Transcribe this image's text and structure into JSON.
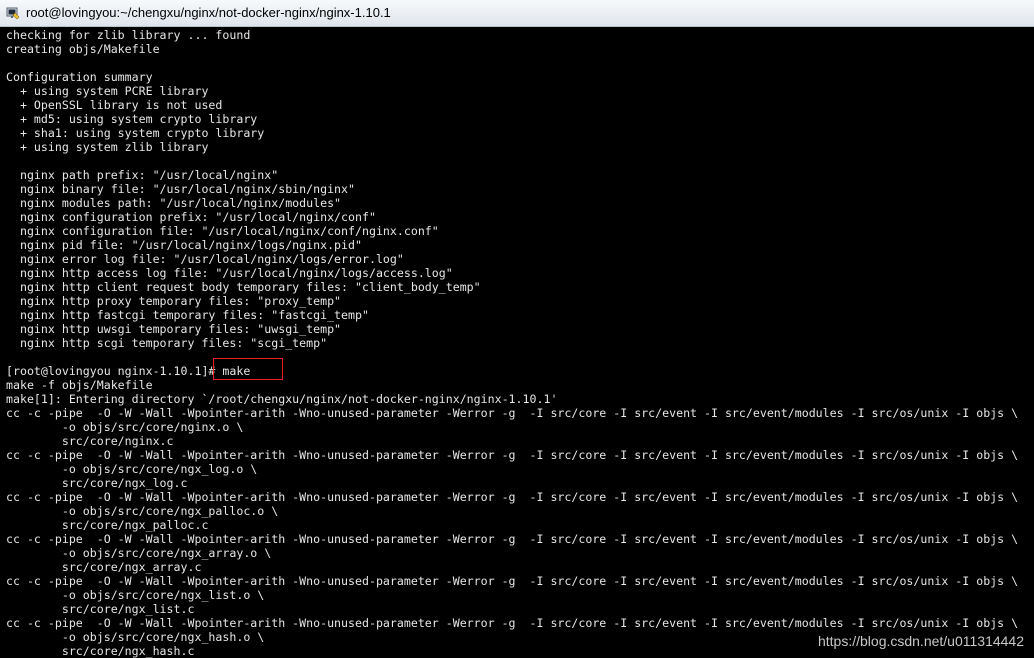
{
  "window": {
    "title": "root@lovingyou:~/chengxu/nginx/not-docker-nginx/nginx-1.10.1"
  },
  "terminal": {
    "lines": [
      "checking for zlib library ... found",
      "creating objs/Makefile",
      "",
      "Configuration summary",
      "  + using system PCRE library",
      "  + OpenSSL library is not used",
      "  + md5: using system crypto library",
      "  + sha1: using system crypto library",
      "  + using system zlib library",
      "",
      "  nginx path prefix: \"/usr/local/nginx\"",
      "  nginx binary file: \"/usr/local/nginx/sbin/nginx\"",
      "  nginx modules path: \"/usr/local/nginx/modules\"",
      "  nginx configuration prefix: \"/usr/local/nginx/conf\"",
      "  nginx configuration file: \"/usr/local/nginx/conf/nginx.conf\"",
      "  nginx pid file: \"/usr/local/nginx/logs/nginx.pid\"",
      "  nginx error log file: \"/usr/local/nginx/logs/error.log\"",
      "  nginx http access log file: \"/usr/local/nginx/logs/access.log\"",
      "  nginx http client request body temporary files: \"client_body_temp\"",
      "  nginx http proxy temporary files: \"proxy_temp\"",
      "  nginx http fastcgi temporary files: \"fastcgi_temp\"",
      "  nginx http uwsgi temporary files: \"uwsgi_temp\"",
      "  nginx http scgi temporary files: \"scgi_temp\"",
      "",
      "[root@lovingyou nginx-1.10.1]# make",
      "make -f objs/Makefile",
      "make[1]: Entering directory `/root/chengxu/nginx/not-docker-nginx/nginx-1.10.1'",
      "cc -c -pipe  -O -W -Wall -Wpointer-arith -Wno-unused-parameter -Werror -g  -I src/core -I src/event -I src/event/modules -I src/os/unix -I objs \\",
      "        -o objs/src/core/nginx.o \\",
      "        src/core/nginx.c",
      "cc -c -pipe  -O -W -Wall -Wpointer-arith -Wno-unused-parameter -Werror -g  -I src/core -I src/event -I src/event/modules -I src/os/unix -I objs \\",
      "        -o objs/src/core/ngx_log.o \\",
      "        src/core/ngx_log.c",
      "cc -c -pipe  -O -W -Wall -Wpointer-arith -Wno-unused-parameter -Werror -g  -I src/core -I src/event -I src/event/modules -I src/os/unix -I objs \\",
      "        -o objs/src/core/ngx_palloc.o \\",
      "        src/core/ngx_palloc.c",
      "cc -c -pipe  -O -W -Wall -Wpointer-arith -Wno-unused-parameter -Werror -g  -I src/core -I src/event -I src/event/modules -I src/os/unix -I objs \\",
      "        -o objs/src/core/ngx_array.o \\",
      "        src/core/ngx_array.c",
      "cc -c -pipe  -O -W -Wall -Wpointer-arith -Wno-unused-parameter -Werror -g  -I src/core -I src/event -I src/event/modules -I src/os/unix -I objs \\",
      "        -o objs/src/core/ngx_list.o \\",
      "        src/core/ngx_list.c",
      "cc -c -pipe  -O -W -Wall -Wpointer-arith -Wno-unused-parameter -Werror -g  -I src/core -I src/event -I src/event/modules -I src/os/unix -I objs \\",
      "        -o objs/src/core/ngx_hash.o \\",
      "        src/core/ngx_hash.c"
    ]
  },
  "watermark": {
    "text": "https://blog.csdn.net/u011314442"
  },
  "colors": {
    "terminal_bg": "#000000",
    "terminal_fg": "#e6e6e6",
    "highlight_border": "#e8201f"
  },
  "icons": {
    "title_icon": "putty-terminal-icon"
  }
}
